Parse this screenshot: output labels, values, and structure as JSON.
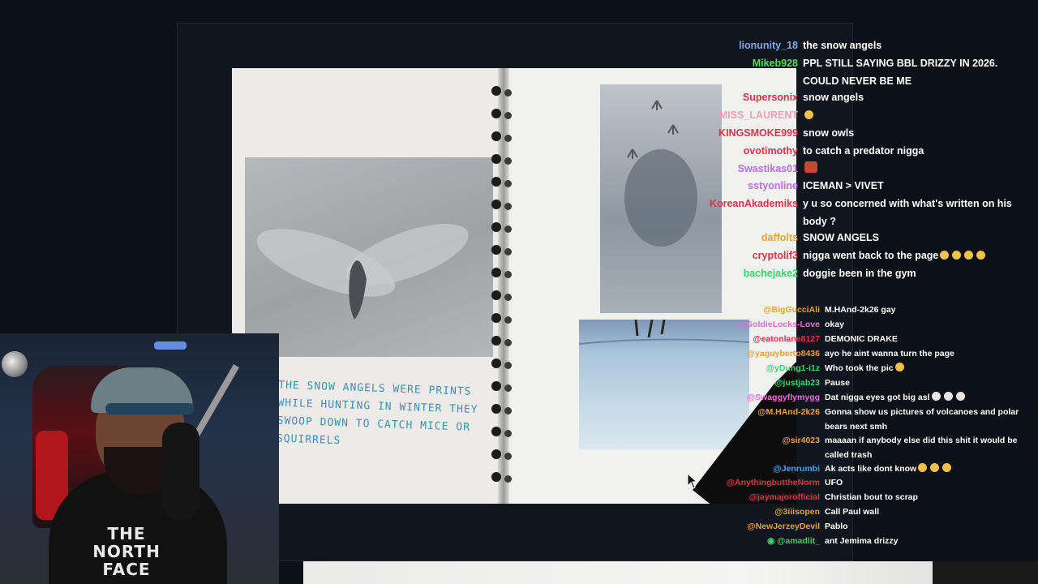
{
  "page_notes": {
    "handwritten_note": "THE SNOW ANGELS WERE PRINTS WHILE HUNTING IN WINTER THEY SWOOP DOWN TO CATCH MICE OR SQUIRRELS"
  },
  "webcam": {
    "shirt_text": "THE NORTH FACE"
  },
  "chat_upper": [
    {
      "user": "lionunity_18",
      "color": "#7ea7e8",
      "text": "the snow angels"
    },
    {
      "user": "Mikeb928",
      "color": "#52e05c",
      "text": "PPL STILL SAYING BBL DRIZZY IN 2026. COULD NEVER BE ME"
    },
    {
      "user": "Supersonix",
      "color": "#e0334a",
      "text": "snow angels"
    },
    {
      "user": "MISS_LAURENT",
      "color": "#f0a0b4",
      "text": "",
      "emoji": [
        "laugh"
      ]
    },
    {
      "user": "KINGSMOKE999",
      "color": "#e0334a",
      "text": "snow owls"
    },
    {
      "user": "ovotimothy",
      "color": "#e0334a",
      "text": "to catch a predator nigga"
    },
    {
      "user": "Swastikas01",
      "color": "#b86cf0",
      "text": "",
      "emoji": [
        "face"
      ]
    },
    {
      "user": "sstyonline",
      "color": "#b86cf0",
      "text": "ICEMAN > VIVET"
    },
    {
      "user": "KoreanAkademiks",
      "color": "#e0334a",
      "text": "y u so concerned with what's written on his body ?"
    },
    {
      "user": "daffolts",
      "color": "#e7a23c",
      "text": "SNOW ANGELS"
    },
    {
      "user": "cryptolif3",
      "color": "#e0334a",
      "text": "nigga went back to the page",
      "emoji": [
        "laugh",
        "laugh",
        "laugh",
        "laugh"
      ]
    },
    {
      "user": "bachejake2",
      "color": "#38d36a",
      "text": "doggie been in the gym"
    }
  ],
  "chat_lower": [
    {
      "user": "@BigGucciAli",
      "color": "#e7a23c",
      "text": "M.HAnd-2k26 gay"
    },
    {
      "user": "@GoldieLocks-Love",
      "color": "#e86dd8",
      "text": "okay"
    },
    {
      "user": "@eatonlane8127",
      "color": "#e0334a",
      "text": "DEMONIC DRAKE"
    },
    {
      "user": "@yaguyberto8436",
      "color": "#e7a23c",
      "text": "ayo he aint wanna turn the page"
    },
    {
      "user": "@yDung1-i1z",
      "color": "#38d36a",
      "text": "Who took the pic",
      "emoji": [
        "rofl"
      ]
    },
    {
      "user": "@justjab23",
      "color": "#38d36a",
      "text": "Pause"
    },
    {
      "user": "@Swaggyflymygg",
      "color": "#e86dd8",
      "text": "Dat nigga eyes got big asl",
      "emoji": [
        "skull",
        "skull",
        "skull"
      ]
    },
    {
      "user": "@M.HAnd-2k26",
      "color": "#e7a23c",
      "text": "Gonna show us pictures of volcanoes and polar bears next smh"
    },
    {
      "user": "@sir4023",
      "color": "#e7a23c",
      "text": "maaaan if anybody else did this shit it would be called trash"
    },
    {
      "user": "@Jenrumbi",
      "color": "#4aa0f0",
      "text": "Ak acts like dont know",
      "emoji": [
        "laugh",
        "laugh",
        "laugh"
      ]
    },
    {
      "user": "@AnythingbuttheNorm",
      "color": "#e0334a",
      "text": "UFO"
    },
    {
      "user": "@jaymajorofficial",
      "color": "#e0334a",
      "text": "Christian bout to scrap"
    },
    {
      "user": "@3iiisopen",
      "color": "#e7a23c",
      "text": "Call Paul wall"
    },
    {
      "user": "@NewJerzeyDevil",
      "color": "#e7a23c",
      "text": "Pablo"
    },
    {
      "user": "@amadlit_",
      "color": "#38d36a",
      "text": "ant Jemima drizzy",
      "badge": "eye-icon"
    }
  ]
}
